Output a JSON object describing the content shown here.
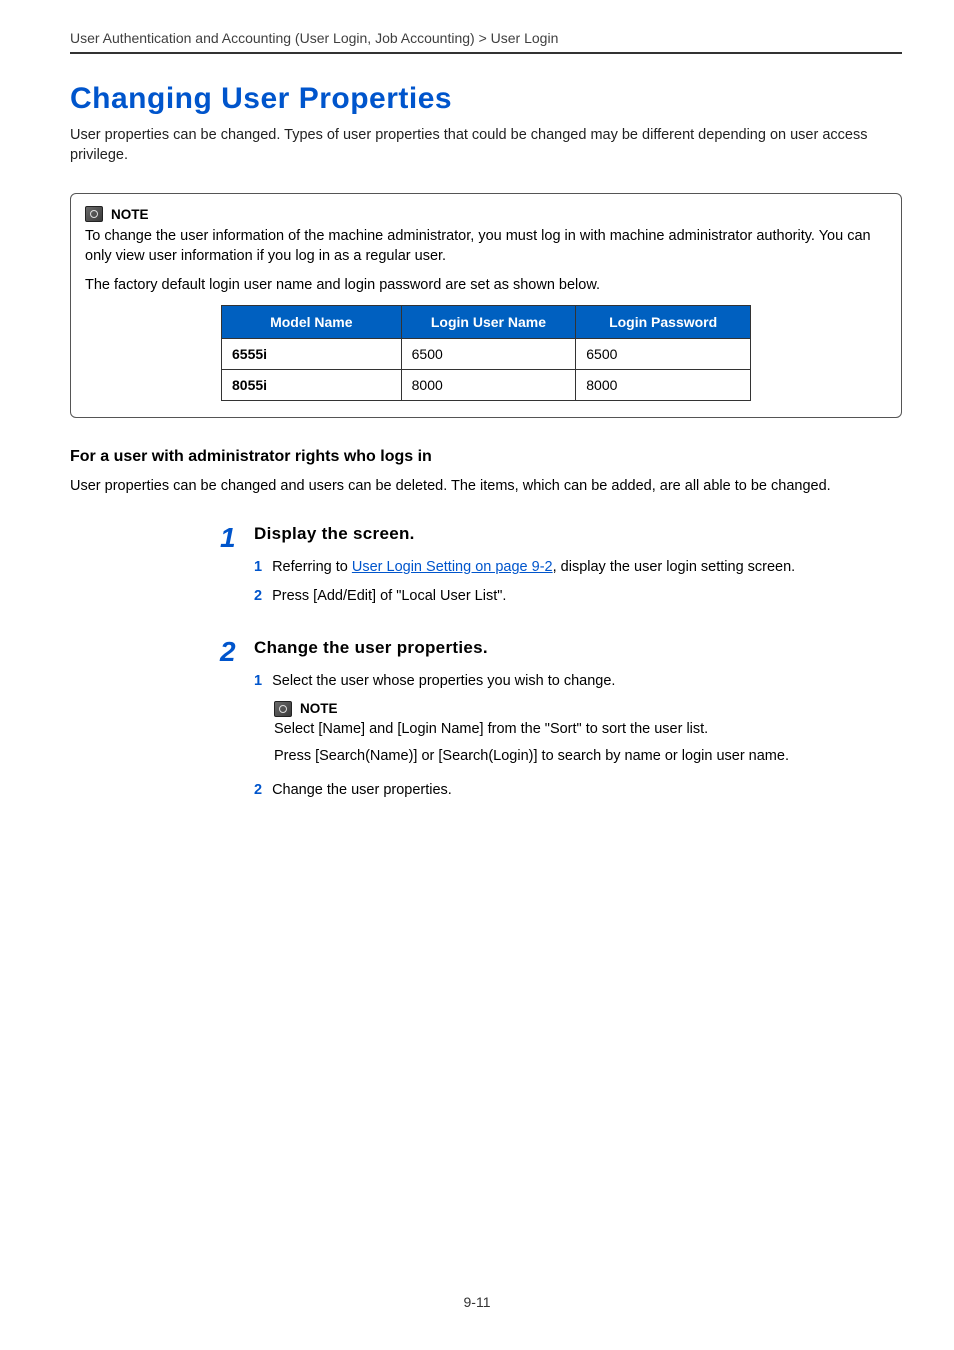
{
  "breadcrumb": "User Authentication and Accounting (User Login, Job Accounting) > User Login",
  "heading": "Changing User Properties",
  "intro": "User properties can be changed. Types of user properties that could be changed may be different depending on user access privilege.",
  "note1": {
    "label": "NOTE",
    "p1": "To change the user information of the machine administrator, you must log in with machine administrator authority. You can only view user information if you log in as a regular user.",
    "p2": "The factory default login user name and login password are set as shown below.",
    "table": {
      "headers": [
        "Model Name",
        "Login User Name",
        "Login Password"
      ],
      "rows": [
        [
          "6555i",
          "6500",
          "6500"
        ],
        [
          "8055i",
          "8000",
          "8000"
        ]
      ]
    }
  },
  "admin": {
    "heading": "For a user with administrator rights who logs in",
    "desc": "User properties can be changed and users can be deleted. The items, which can be added, are all able to be changed."
  },
  "step1": {
    "num": "1",
    "title": "Display the screen.",
    "sub1": {
      "num": "1",
      "pre": "Referring to ",
      "link": "User Login Setting on page 9-2",
      "post": ", display the user login setting screen."
    },
    "sub2": {
      "num": "2",
      "text": "Press [Add/Edit] of \"Local User List\"."
    }
  },
  "step2": {
    "num": "2",
    "title": "Change the user properties.",
    "sub1": {
      "num": "1",
      "text": "Select the user whose properties you wish to change."
    },
    "note": {
      "label": "NOTE",
      "p1": "Select [Name] and [Login Name] from the \"Sort\" to sort the user list.",
      "p2": "Press [Search(Name)] or [Search(Login)] to search by name or login user name."
    },
    "sub2": {
      "num": "2",
      "text": "Change the user properties."
    }
  },
  "page_num": "9-11"
}
